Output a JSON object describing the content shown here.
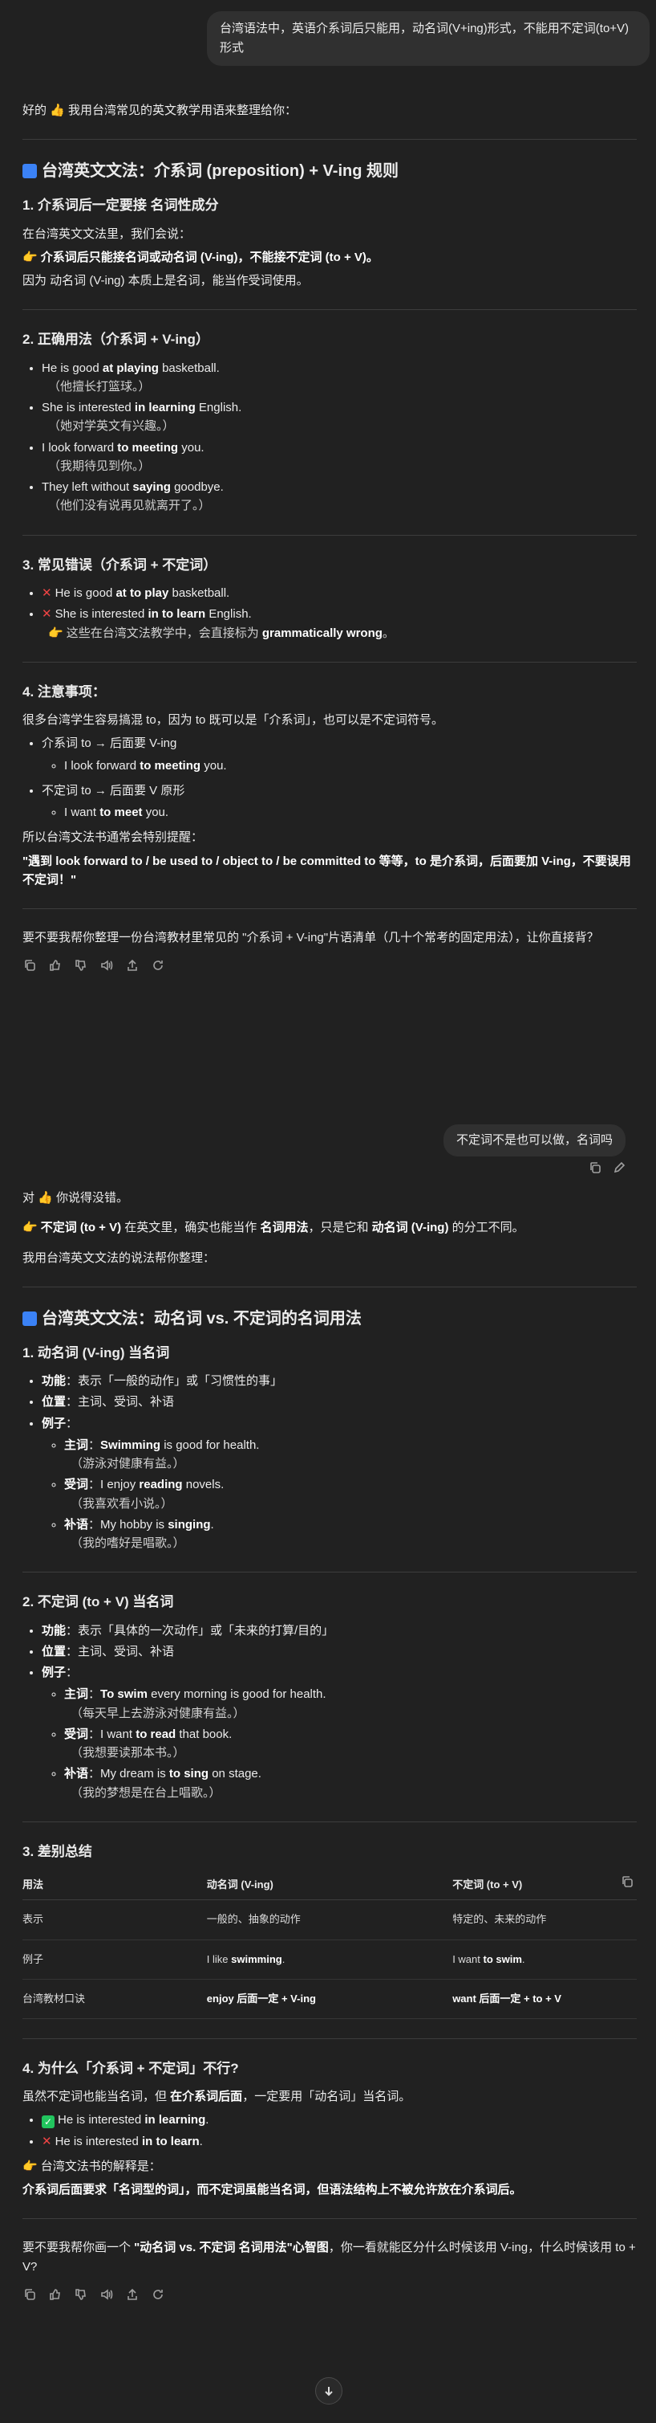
{
  "user1": "台湾语法中，英语介系词后只能用，动名词(V+ing)形式，不能用不定词(to+V)形式",
  "a1": {
    "intro": "好的 👍 我用台湾常见的英文教学用语来整理给你：",
    "title": "台湾英文文法：介系词 (preposition) + V-ing 规则",
    "s1": {
      "h": "1. 介系词后一定要接 名词性成分",
      "p1": "在台湾英文文法里，我们会说：",
      "p2": "介系词后只能接名词或动名词 (V-ing)，不能接不定词 (to + V)。",
      "p3": "因为 动名词 (V-ing) 本质上是名词，能当作受词使用。"
    },
    "s2": {
      "h": "2. 正确用法（介系词 + V-ing）",
      "items": [
        {
          "en_a": "He is good ",
          "en_b": "at playing",
          "en_c": " basketball.",
          "zh": "（他擅长打篮球。）"
        },
        {
          "en_a": "She is interested ",
          "en_b": "in learning",
          "en_c": " English.",
          "zh": "（她对学英文有兴趣。）"
        },
        {
          "en_a": "I look forward ",
          "en_b": "to meeting",
          "en_c": " you.",
          "zh": "（我期待见到你。）"
        },
        {
          "en_a": "They left without ",
          "en_b": "saying",
          "en_c": " goodbye.",
          "zh": "（他们没有说再见就离开了。）"
        }
      ]
    },
    "s3": {
      "h": "3. 常见错误（介系词 + 不定词）",
      "items": [
        {
          "a": "He is good ",
          "b": "at to play",
          "c": " basketball."
        },
        {
          "a": "She is interested ",
          "b": "in to learn",
          "c": " English."
        }
      ],
      "note_a": "这些在台湾文法教学中，会直接标为 ",
      "note_b": "grammatically wrong",
      "note_c": "。"
    },
    "s4": {
      "h": "4. 注意事项：",
      "p1": "很多台湾学生容易搞混 to，因为 to 既可以是「介系词」，也可以是不定词符号。",
      "li1": "介系词 to → 后面要 V-ing",
      "li1a_a": "I look forward ",
      "li1a_b": "to meeting",
      "li1a_c": " you.",
      "li2": "不定词 to → 后面要 V 原形",
      "li2a_a": "I want ",
      "li2a_b": "to meet",
      "li2a_c": " you.",
      "p2": "所以台湾文法书通常会特别提醒：",
      "p3": "\"遇到 look forward to / be used to / object to / be committed to 等等，to 是介系词，后面要加 V-ing，不要误用不定词！\""
    },
    "closing": "要不要我帮你整理一份台湾教材里常见的 \"介系词 + V-ing\"片语清单（几十个常考的固定用法），让你直接背？"
  },
  "user2": "不定词不是也可以做，名词吗",
  "a2": {
    "p1": "对 👍 你说得没错。",
    "p2_a": "不定词 (to + V)",
    "p2_b": " 在英文里，确实也能当作 ",
    "p2_c": "名词用法",
    "p2_d": "，只是它和 ",
    "p2_e": "动名词 (V-ing)",
    "p2_f": " 的分工不同。",
    "p3": "我用台湾英文文法的说法帮你整理：",
    "title": "台湾英文文法：动名词 vs. 不定词的名词用法",
    "s1": {
      "h": "1. 动名词 (V-ing) 当名词",
      "func_k": "功能",
      "func_v": "：表示「一般的动作」或「习惯性的事」",
      "pos_k": "位置",
      "pos_v": "：主词、受词、补语",
      "ex_k": "例子",
      "ex": [
        {
          "k": "主词",
          "a": "：",
          "b": "Swimming",
          "c": " is good for health.",
          "zh": "（游泳对健康有益。）"
        },
        {
          "k": "受词",
          "a": "：I enjoy ",
          "b": "reading",
          "c": " novels.",
          "zh": "（我喜欢看小说。）"
        },
        {
          "k": "补语",
          "a": "：My hobby is ",
          "b": "singing",
          "c": ".",
          "zh": "（我的嗜好是唱歌。）"
        }
      ]
    },
    "s2": {
      "h": "2. 不定词 (to + V) 当名词",
      "func_k": "功能",
      "func_v": "：表示「具体的一次动作」或「未来的打算/目的」",
      "pos_k": "位置",
      "pos_v": "：主词、受词、补语",
      "ex_k": "例子",
      "ex": [
        {
          "k": "主词",
          "a": "：",
          "b": "To swim",
          "c": " every morning is good for health.",
          "zh": "（每天早上去游泳对健康有益。）"
        },
        {
          "k": "受词",
          "a": "：I want ",
          "b": "to read",
          "c": " that book.",
          "zh": "（我想要读那本书。）"
        },
        {
          "k": "补语",
          "a": "：My dream is ",
          "b": "to sing",
          "c": " on stage.",
          "zh": "（我的梦想是在台上唱歌。）"
        }
      ]
    },
    "s3": {
      "h": "3. 差别总结",
      "headers": [
        "用法",
        "动名词 (V-ing)",
        "不定词 (to + V)"
      ],
      "rows": [
        {
          "c0": "表示",
          "c1a": "一般的、抽象的动作",
          "c1b": "",
          "c1c": "",
          "c2a": "特定的、未来的动作",
          "c2b": "",
          "c2c": ""
        },
        {
          "c0": "例子",
          "c1a": "I like ",
          "c1b": "swimming",
          "c1c": ".",
          "c2a": "I want ",
          "c2b": "to swim",
          "c2c": "."
        },
        {
          "c0": "台湾教材口诀",
          "c1a": "",
          "c1b": "enjoy 后面一定 + V-ing",
          "c1c": "",
          "c2a": "",
          "c2b": "want 后面一定 + to + V",
          "c2c": ""
        }
      ]
    },
    "s4": {
      "h": "4. 为什么「介系词 + 不定词」不行?",
      "p1_a": "虽然不定词也能当名词，但 ",
      "p1_b": "在介系词后面",
      "p1_c": "，一定要用「动名词」当名词。",
      "ok_a": "He is interested ",
      "ok_b": "in learning",
      "ok_c": ".",
      "bad_a": "He is interested ",
      "bad_b": "in to learn",
      "bad_c": ".",
      "p2": "台湾文法书的解释是：",
      "p3": "介系词后面要求「名词型的词」，而不定词虽能当名词，但语法结构上不被允许放在介系词后。"
    },
    "closing_a": "要不要我帮你画一个 ",
    "closing_b": "\"动名词 vs. 不定词 名词用法\"心智图",
    "closing_c": "，你一看就能区分什么时候该用 V-ing，什么时候该用 to + V?"
  }
}
